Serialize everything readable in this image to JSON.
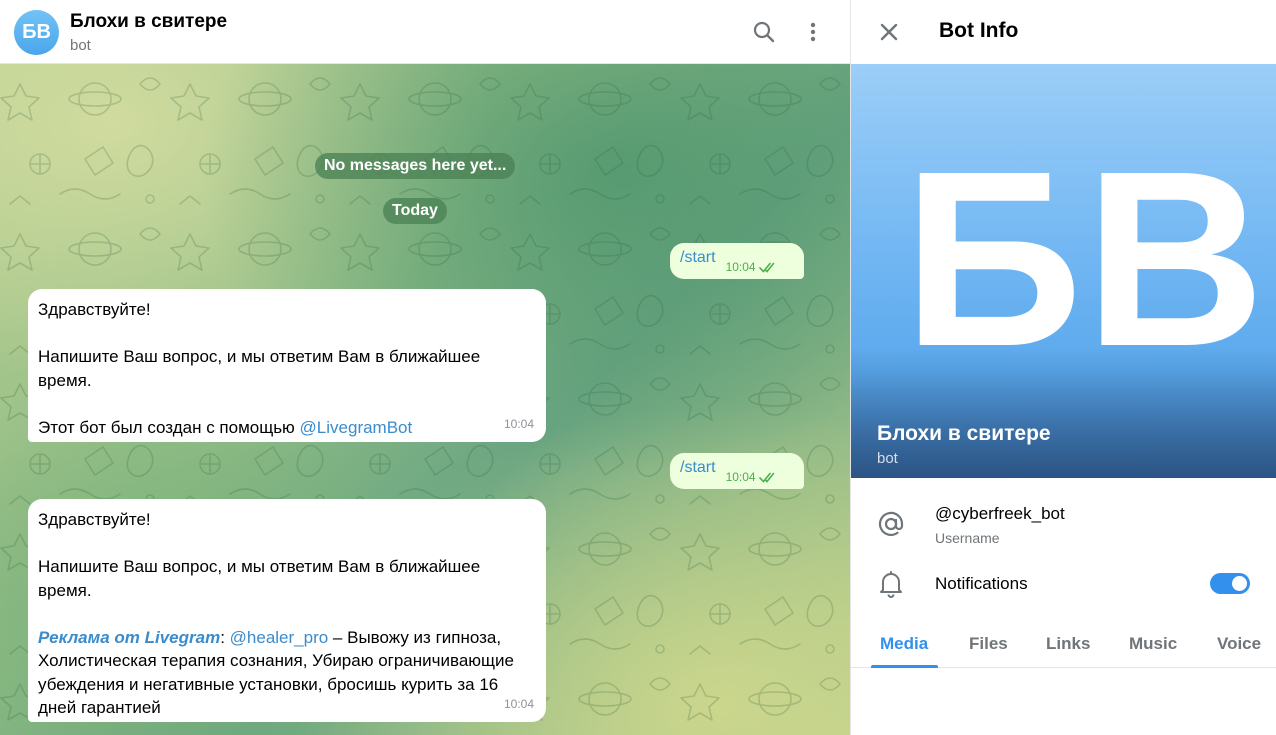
{
  "chat": {
    "title": "Блохи в свитере",
    "subtitle": "bot",
    "avatar_initials": "БВ",
    "header_icons": [
      "search-icon",
      "more-vertical-icon"
    ]
  },
  "service_messages": {
    "empty": "No messages here yet...",
    "date": "Today"
  },
  "messages": {
    "out1": {
      "text": "/start",
      "time": "10:04"
    },
    "in1": {
      "greeting": "Здравствуйте!",
      "body": "Напишите Ваш вопрос, и мы ответим Вам в ближайшее время.",
      "created_prefix": "Этот бот был создан с помощью ",
      "created_link": "@LivegramBot",
      "time": "10:04"
    },
    "out2": {
      "text": "/start",
      "time": "10:04"
    },
    "in2": {
      "greeting": "Здравствуйте!",
      "body": "Напишите Ваш вопрос, и мы ответим Вам в ближайшее время.",
      "ad_label": "Реклама от Livegram",
      "ad_colon": ": ",
      "ad_link": "@healer_pro",
      "ad_text": " – Вывожу из гипноза, Холистическая терапия сознания, Убираю ограничивающие убеждения и негативные установки, бросишь курить за 16 дней  гарантией",
      "time": "10:04"
    }
  },
  "info": {
    "title": "Bot Info",
    "banner_initials": "БВ",
    "name": "Блохи в свитере",
    "kind": "bot",
    "username": "@cyberfreek_bot",
    "username_label": "Username",
    "notifications_label": "Notifications",
    "notifications_on": true,
    "tabs": [
      "Media",
      "Files",
      "Links",
      "Music",
      "Voice"
    ],
    "active_tab": "Media"
  },
  "colors": {
    "accent": "#3390ec",
    "link": "#3a8ccc",
    "outgoing_bubble": "#eeffde",
    "read_check": "#4fae4e"
  }
}
